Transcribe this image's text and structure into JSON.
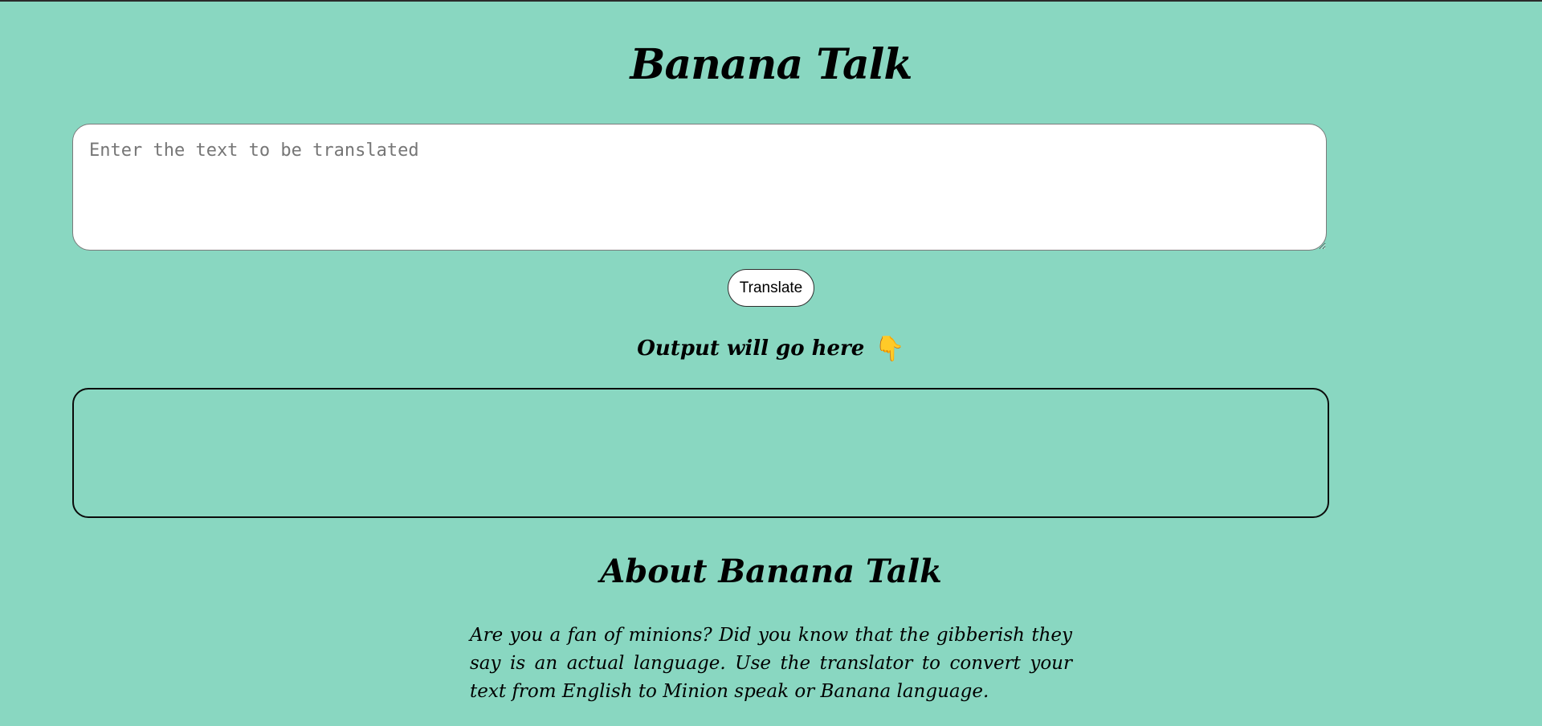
{
  "header": {
    "title": "Banana Talk"
  },
  "translator": {
    "input_placeholder": "Enter the text to be translated",
    "input_value": "",
    "translate_label": "Translate",
    "output_label": "Output will go here",
    "output_emoji": "👇",
    "output_icon": "pointing-down-hand-icon",
    "output_value": ""
  },
  "about": {
    "title": "About Banana Talk",
    "text": "Are you a fan of minions? Did you know that the gibberish they say is an actual language. Use the translator to convert your text from English to Minion speak or Banana language."
  },
  "colors": {
    "background": "#89d7c1",
    "input_background": "#ffffff",
    "emoji": "#f6b92b"
  }
}
